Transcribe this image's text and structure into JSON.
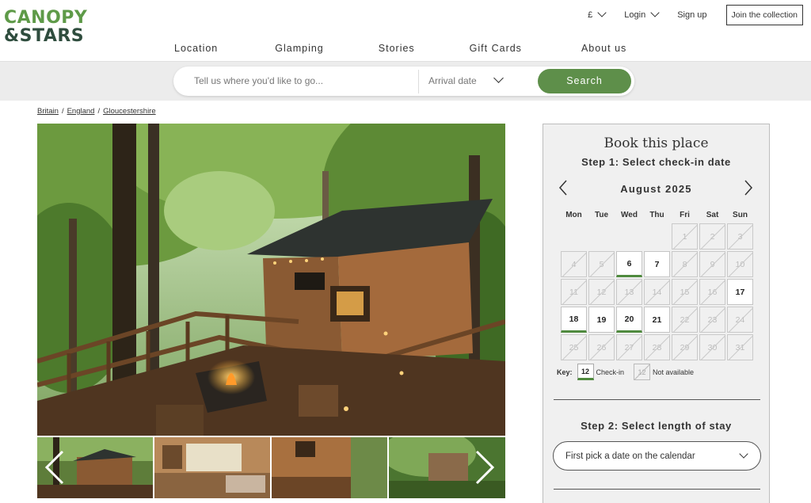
{
  "brand": {
    "line1": "CANOPY",
    "line2": "&STARS"
  },
  "utility": {
    "currency": "£",
    "login": "Login",
    "signup": "Sign up",
    "join": "Join the collection"
  },
  "nav": [
    "Location",
    "Glamping",
    "Stories",
    "Gift Cards",
    "About us"
  ],
  "search": {
    "placeholder": "Tell us where you'd like to go...",
    "arrival": "Arrival date",
    "button": "Search"
  },
  "breadcrumb": [
    "Britain",
    "England",
    "Gloucestershire"
  ],
  "booking": {
    "title": "Book this place",
    "step1": "Step 1: Select check-in date",
    "month": "August 2025",
    "weekdays": [
      "Mon",
      "Tue",
      "Wed",
      "Thu",
      "Fri",
      "Sat",
      "Sun"
    ],
    "weeks": [
      [
        null,
        null,
        null,
        null,
        {
          "d": "1",
          "s": "na"
        },
        {
          "d": "2",
          "s": "na"
        },
        {
          "d": "3",
          "s": "na"
        }
      ],
      [
        {
          "d": "4",
          "s": "na"
        },
        {
          "d": "5",
          "s": "na"
        },
        {
          "d": "6",
          "s": "ci"
        },
        {
          "d": "7",
          "s": "av"
        },
        {
          "d": "8",
          "s": "na"
        },
        {
          "d": "9",
          "s": "na"
        },
        {
          "d": "10",
          "s": "na"
        }
      ],
      [
        {
          "d": "11",
          "s": "na"
        },
        {
          "d": "12",
          "s": "na"
        },
        {
          "d": "13",
          "s": "na"
        },
        {
          "d": "14",
          "s": "na"
        },
        {
          "d": "15",
          "s": "na"
        },
        {
          "d": "16",
          "s": "na"
        },
        {
          "d": "17",
          "s": "av"
        }
      ],
      [
        {
          "d": "18",
          "s": "ci"
        },
        {
          "d": "19",
          "s": "av"
        },
        {
          "d": "20",
          "s": "ci"
        },
        {
          "d": "21",
          "s": "av"
        },
        {
          "d": "22",
          "s": "na"
        },
        {
          "d": "23",
          "s": "na"
        },
        {
          "d": "24",
          "s": "na"
        }
      ],
      [
        {
          "d": "25",
          "s": "na"
        },
        {
          "d": "26",
          "s": "na"
        },
        {
          "d": "27",
          "s": "na"
        },
        {
          "d": "28",
          "s": "na"
        },
        {
          "d": "29",
          "s": "na"
        },
        {
          "d": "30",
          "s": "na"
        },
        {
          "d": "31",
          "s": "na"
        }
      ]
    ],
    "key": {
      "label": "Key:",
      "checkin_num": "12",
      "checkin_text": "Check-in",
      "na_num": "12",
      "na_text": "Not available"
    },
    "step2": "Step 2: Select length of stay",
    "stay_placeholder": "First pick a date on the calendar"
  },
  "colors": {
    "brand_green": "#5e9a48",
    "brand_dark": "#2f4d3e",
    "search_button": "#5e8f4a",
    "checkin_underline": "#4f8a3e"
  }
}
